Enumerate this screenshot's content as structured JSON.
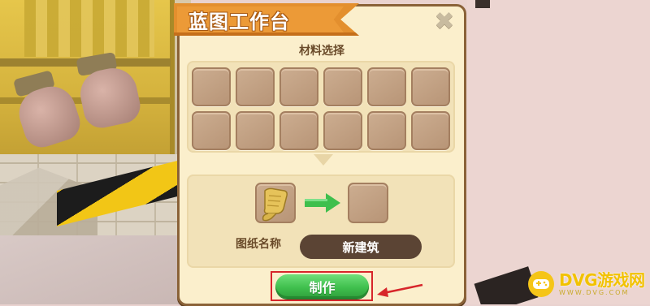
{
  "window": {
    "title": "蓝图工作台",
    "close_icon": "close-icon"
  },
  "materials": {
    "label": "材料选择",
    "slots_count": 12
  },
  "crafting": {
    "blueprint_icon": "blueprint-scroll-icon",
    "arrow_icon": "arrow-right-icon",
    "name_label": "图纸名称",
    "name_value": "新建筑",
    "make_button": "制作"
  },
  "watermark": {
    "main": "DVG游戏网",
    "sub": "WWW.DVG.COM"
  },
  "colors": {
    "panel_bg": "#fbefcc",
    "ribbon": "#e38f2e",
    "slot": "#c4a385",
    "button_green": "#3fbf4d",
    "highlight_red": "#d7262b"
  }
}
